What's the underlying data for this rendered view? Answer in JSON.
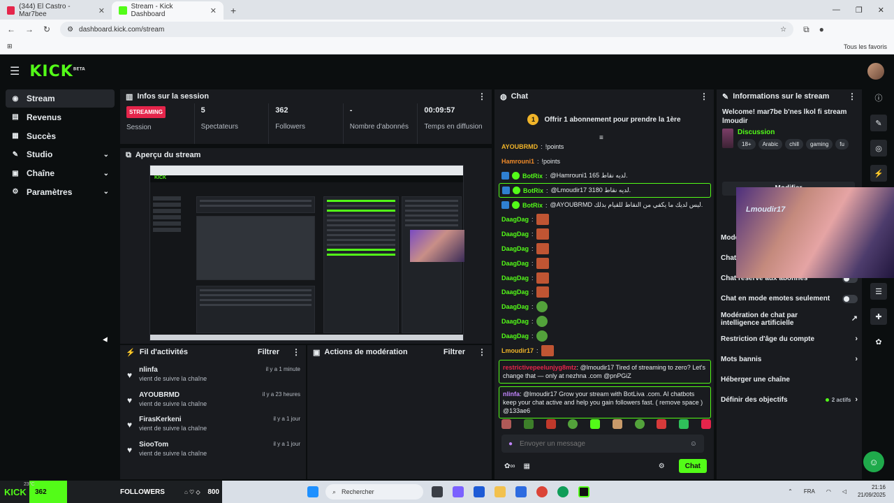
{
  "browser": {
    "tabs": [
      {
        "title": "(344) El Castro - Mar7bee",
        "active": false
      },
      {
        "title": "Stream - Kick Dashboard",
        "active": true
      }
    ],
    "url": "dashboard.kick.com/stream",
    "bookmarks_all": "Tous les favoris"
  },
  "header": {
    "logo": "KICK",
    "logo_sup": "BETA"
  },
  "sidebar": {
    "items": [
      {
        "label": "Stream",
        "icon": "broadcast-icon",
        "active": true
      },
      {
        "label": "Revenus",
        "icon": "money-icon"
      },
      {
        "label": "Succès",
        "icon": "trophy-icon"
      },
      {
        "label": "Studio",
        "icon": "studio-icon",
        "expandable": true
      },
      {
        "label": "Chaîne",
        "icon": "channel-icon",
        "expandable": true
      },
      {
        "label": "Paramètres",
        "icon": "gear-icon",
        "expandable": true
      }
    ]
  },
  "session": {
    "title": "Infos sur la session",
    "status_badge": "STREAMING",
    "stats": [
      {
        "value": "",
        "label": "Session"
      },
      {
        "value": "5",
        "label": "Spectateurs"
      },
      {
        "value": "362",
        "label": "Followers"
      },
      {
        "value": "-",
        "label": "Nombre d'abonnés"
      },
      {
        "value": "00:09:57",
        "label": "Temps en diffusion"
      }
    ]
  },
  "preview": {
    "title": "Aperçu du stream"
  },
  "activity": {
    "title": "Fil d'activités",
    "filter": "Filtrer",
    "items": [
      {
        "name": "nlinfa",
        "action": "vient de suivre la chaîne",
        "time": "il y a 1 minute"
      },
      {
        "name": "AYOUBRMD",
        "action": "vient de suivre la chaîne",
        "time": "il y a 23 heures"
      },
      {
        "name": "FirasKerkeni",
        "action": "vient de suivre la chaîne",
        "time": "il y a 1 jour"
      },
      {
        "name": "SiooTom",
        "action": "vient de suivre la chaîne",
        "time": "il y a 1 jour"
      }
    ]
  },
  "moderation": {
    "title": "Actions de modération",
    "filter": "Filtrer"
  },
  "chat": {
    "title": "Chat",
    "pinned": {
      "badge": "1",
      "text": "Offrir 1 abonnement pour prendre la 1ère"
    },
    "messages": [
      {
        "user": "AYOUBRMD",
        "text": "!points",
        "color": "#f0b429"
      },
      {
        "user": "Hamrouni1",
        "text": "!points",
        "color": "#f08a29"
      },
      {
        "user": "BotRix",
        "text": "@Hamrouni1 165 لديه نقاط.",
        "color": "#53fc18",
        "bot": true
      },
      {
        "user": "BotRix",
        "text": "@Lmoudir17 3180 لديه نقاط.",
        "color": "#53fc18",
        "bot": true,
        "highlight": true
      },
      {
        "user": "BotRix",
        "text": "@AYOUBRMD ليس لديك ما يكفي من النقاط للقيام بذلك.",
        "color": "#53fc18",
        "bot": true
      },
      {
        "user": "DaagDag",
        "text": "",
        "color": "#53fc18",
        "emote": "red"
      },
      {
        "user": "DaagDag",
        "text": "",
        "color": "#53fc18",
        "emote": "red"
      },
      {
        "user": "DaagDag",
        "text": "",
        "color": "#53fc18",
        "emote": "red"
      },
      {
        "user": "DaagDag",
        "text": "",
        "color": "#53fc18",
        "emote": "red"
      },
      {
        "user": "DaagDag",
        "text": "",
        "color": "#53fc18",
        "emote": "red"
      },
      {
        "user": "DaagDag",
        "text": "",
        "color": "#53fc18",
        "emote": "red"
      },
      {
        "user": "DaagDag",
        "text": "",
        "color": "#53fc18",
        "emote": "green"
      },
      {
        "user": "DaagDag",
        "text": "",
        "color": "#53fc18",
        "emote": "green"
      },
      {
        "user": "DaagDag",
        "text": "",
        "color": "#53fc18",
        "emote": "green"
      },
      {
        "user": "Lmoudir17",
        "text": "",
        "color": "#f0b429",
        "emote": "red"
      }
    ],
    "boxed_messages": [
      {
        "user": "restrictivepeelunjyg8mtz",
        "text": "@lmoudir17 Tired of streaming to zero? Let's change that — only at nezhna .com @pnPGiZ",
        "color": "#e5254b"
      },
      {
        "user": "nlinfa",
        "text": "@lmoudir17 Grow your stream with BotLiva .com. AI chatbots keep your chat active and help you gain followers fast. ( remove space ) @133ae6",
        "color": "#c084fc"
      }
    ],
    "input_placeholder": "Envoyer un message",
    "send_label": "Chat"
  },
  "stream_info": {
    "title": "Informations sur le stream",
    "stream_title": "Welcome! mar7be b'nes lkol fi stream lmoudir",
    "category": "Discussion",
    "tags": [
      "18+",
      "Arabic",
      "chill",
      "gaming",
      "fu"
    ],
    "edit_label": "Modifier",
    "settings": [
      {
        "label": "Mode",
        "type": "plain"
      },
      {
        "label": "Chat",
        "type": "plain"
      },
      {
        "label": "Chat réservé aux abonnés",
        "type": "toggle"
      },
      {
        "label": "Chat en mode emotes seulement",
        "type": "toggle"
      },
      {
        "label": "Modération de chat par intelligence artificielle",
        "type": "external"
      },
      {
        "label": "Restriction d'âge du compte",
        "type": "chevron"
      },
      {
        "label": "Mots bannis",
        "type": "chevron"
      },
      {
        "label": "Héberger une chaîne",
        "type": "plain"
      },
      {
        "label": "Définir des objectifs",
        "type": "count",
        "count": "2 actifs"
      }
    ]
  },
  "webcam": {
    "label": "Lmoudir17"
  },
  "taskbar": {
    "kick_logo": "KICK",
    "followers_count": "362",
    "followers_label": "FOLLOWERS",
    "goal": "800",
    "weather": "23°C",
    "search_placeholder": "Rechercher",
    "lang": "FRA",
    "time": "21:16",
    "date": "21/09/2025"
  },
  "colors": {
    "accent": "#53fc18",
    "streaming": "#e5254b",
    "panel": "#191b1f",
    "background": "#0b0e0f"
  }
}
